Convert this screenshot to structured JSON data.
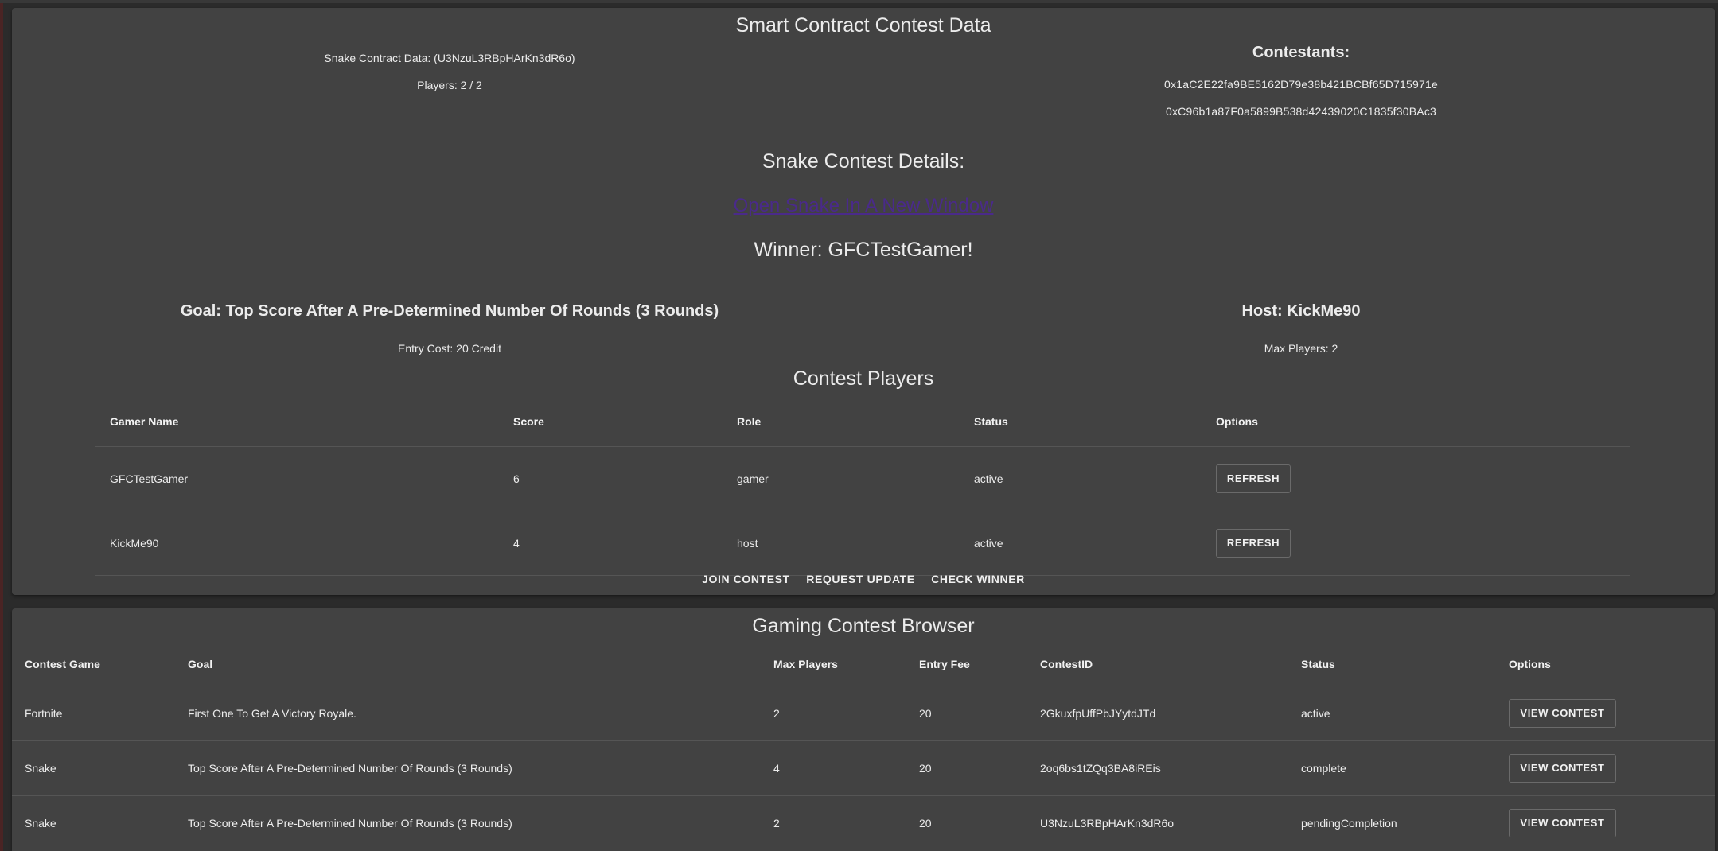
{
  "contest": {
    "title": "Smart Contract Contest Data",
    "contract_data": "Snake Contract Data: (U3NzuL3RBpHArKn3dR6o)",
    "players": "Players: 2 / 2",
    "contestants_heading": "Contestants:",
    "contestants": [
      "0x1aC2E22fa9BE5162D79e38b421BCBf65D715971e",
      "0xC96b1a87F0a5899B538d42439020C1835f30BAc3"
    ],
    "details_heading": "Snake Contest Details:",
    "open_link": "Open Snake In A New Window",
    "winner": "Winner: GFCTestGamer!",
    "goal": "Goal: Top Score After A Pre-Determined Number Of Rounds (3 Rounds)",
    "entry_cost": "Entry Cost: 20 Credit",
    "host": "Host: KickMe90",
    "max_players": "Max Players: 2",
    "players_heading": "Contest Players",
    "players_table": {
      "headers": [
        "Gamer Name",
        "Score",
        "Role",
        "Status",
        "Options"
      ],
      "rows": [
        {
          "name": "GFCTestGamer",
          "score": "6",
          "role": "gamer",
          "status": "active",
          "option": "REFRESH"
        },
        {
          "name": "KickMe90",
          "score": "4",
          "role": "host",
          "status": "active",
          "option": "REFRESH"
        }
      ]
    },
    "actions": {
      "join": "JOIN CONTEST",
      "request_update": "REQUEST UPDATE",
      "check_winner": "CHECK WINNER"
    }
  },
  "browser": {
    "title": "Gaming Contest Browser",
    "headers": [
      "Contest Game",
      "Goal",
      "Max Players",
      "Entry Fee",
      "ContestID",
      "Status",
      "Options"
    ],
    "rows": [
      {
        "game": "Fortnite",
        "goal": "First One To Get A Victory Royale.",
        "max_players": "2",
        "entry_fee": "20",
        "contest_id": "2GkuxfpUffPbJYytdJTd",
        "status": "active",
        "option": "VIEW CONTEST"
      },
      {
        "game": "Snake",
        "goal": "Top Score After A Pre-Determined Number Of Rounds (3 Rounds)",
        "max_players": "4",
        "entry_fee": "20",
        "contest_id": "2oq6bs1tZQq3BA8iREis",
        "status": "complete",
        "option": "VIEW CONTEST"
      },
      {
        "game": "Snake",
        "goal": "Top Score After A Pre-Determined Number Of Rounds (3 Rounds)",
        "max_players": "2",
        "entry_fee": "20",
        "contest_id": "U3NzuL3RBpHArKn3dR6o",
        "status": "pendingCompletion",
        "option": "VIEW CONTEST"
      }
    ]
  },
  "colors": {
    "page_background": "#2b2b2b",
    "card_background": "#424242",
    "link": "#4a2a8a",
    "divider": "#555555"
  }
}
